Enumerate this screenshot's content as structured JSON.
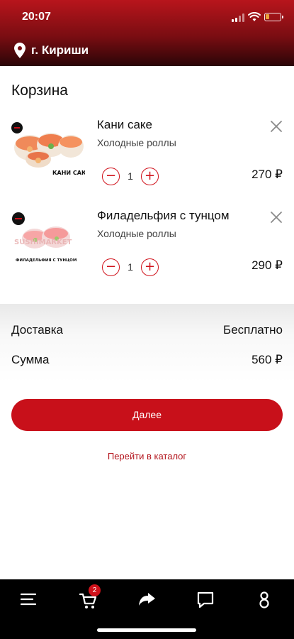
{
  "status": {
    "time": "20:07"
  },
  "header": {
    "city": "г. Кириши",
    "icon": "location-pin-icon"
  },
  "page": {
    "title": "Корзина"
  },
  "cart": {
    "items": [
      {
        "name": "Кани саке",
        "category": "Холодные роллы",
        "quantity": "1",
        "price": "270 ₽",
        "image_caption": "КАНИ САКЕ"
      },
      {
        "name": "Филадельфия с тунцом",
        "category": "Холодные роллы",
        "quantity": "1",
        "price": "290 ₽",
        "image_caption": "ФИЛАДЕЛЬФИЯ С ТУНЦОМ",
        "image_watermark": "SUSHIMARKET"
      }
    ]
  },
  "summary": {
    "delivery_label": "Доставка",
    "delivery_value": "Бесплатно",
    "total_label": "Сумма",
    "total_value": "560 ₽"
  },
  "actions": {
    "next_label": "Далее",
    "catalog_link": "Перейти в каталог"
  },
  "tabbar": {
    "cart_badge": "2",
    "tabs": [
      "menu-icon",
      "cart-icon",
      "share-icon",
      "chat-icon",
      "profile-icon"
    ]
  },
  "colors": {
    "accent": "#c8101a",
    "header_top": "#b8151c",
    "header_bottom": "#2a0507",
    "tabbar": "#000000"
  }
}
